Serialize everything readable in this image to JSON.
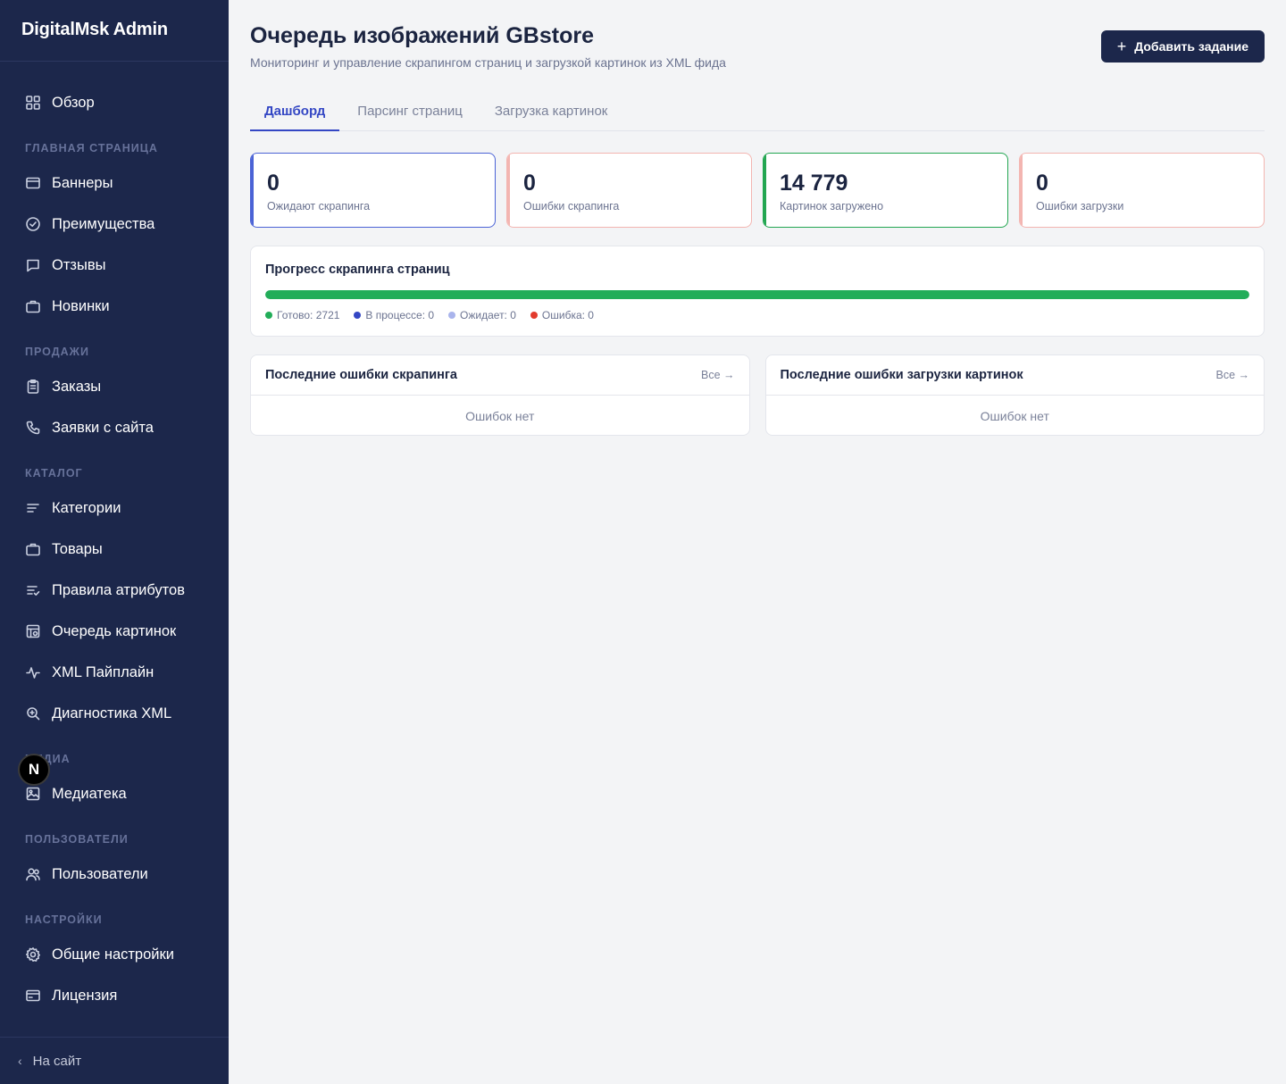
{
  "sidebar": {
    "brand": "DigitalMsk Admin",
    "overview": "Обзор",
    "sections": {
      "home": "ГЛАВНАЯ СТРАНИЦА",
      "sales": "ПРОДАЖИ",
      "catalog": "КАТАЛОГ",
      "media": "МЕДИА",
      "users": "ПОЛЬЗОВАТЕЛИ",
      "settings": "НАСТРОЙКИ"
    },
    "items": {
      "banners": "Баннеры",
      "advantages": "Преимущества",
      "reviews": "Отзывы",
      "novelties": "Новинки",
      "orders": "Заказы",
      "requests": "Заявки с сайта",
      "categories": "Категории",
      "products": "Товары",
      "attr_rules": "Правила атрибутов",
      "image_queue": "Очередь картинок",
      "xml_pipeline": "XML Пайплайн",
      "xml_diag": "Диагностика XML",
      "media_library": "Медиатека",
      "users": "Пользователи",
      "general_settings": "Общие настройки",
      "license": "Лицензия"
    },
    "footer": "На сайт",
    "next_badge": "N"
  },
  "header": {
    "title": "Очередь изображений GBstore",
    "subtitle": "Мониторинг и управление скрапингом страниц и загрузкой картинок из XML фида",
    "add_button": "Добавить задание"
  },
  "tabs": [
    "Дашборд",
    "Парсинг страниц",
    "Загрузка картинок"
  ],
  "stats": [
    {
      "value": "0",
      "label": "Ожидают скрапинга"
    },
    {
      "value": "0",
      "label": "Ошибки скрапинга"
    },
    {
      "value": "14 779",
      "label": "Картинок загружено"
    },
    {
      "value": "0",
      "label": "Ошибки загрузки"
    }
  ],
  "progress": {
    "title": "Прогресс скрапинга страниц",
    "fill_percent": 100,
    "legend": [
      {
        "label": "Готово: 2721",
        "color": "#22ad59"
      },
      {
        "label": "В процессе: 0",
        "color": "#3447c4"
      },
      {
        "label": "Ожидает: 0",
        "color": "#a9b4ec"
      },
      {
        "label": "Ошибка: 0",
        "color": "#e23b2e"
      }
    ]
  },
  "panels": [
    {
      "title": "Последние ошибки скрапинга",
      "link": "Все →",
      "empty": "Ошибок нет"
    },
    {
      "title": "Последние ошибки загрузки картинок",
      "link": "Все →",
      "empty": "Ошибок нет"
    }
  ]
}
